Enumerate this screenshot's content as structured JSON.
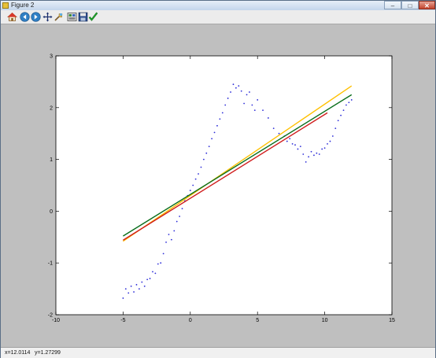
{
  "window": {
    "title": "Figure 2",
    "min_glyph": "–",
    "max_glyph": "□",
    "close_glyph": "✕"
  },
  "toolbar": {
    "tools": [
      "home-icon",
      "back-icon",
      "forward-icon",
      "pan-icon",
      "zoom-icon",
      "configure-subplots-icon",
      "save-icon",
      "edit-axis-icon"
    ]
  },
  "status": {
    "x": "x=12.0114",
    "y": "y=1.27299"
  },
  "chart_data": {
    "type": "scatter",
    "xlim": [
      -10,
      15
    ],
    "ylim": [
      -2,
      3
    ],
    "xticks": [
      -10,
      -5,
      0,
      5,
      10,
      15
    ],
    "yticks": [
      -2,
      -1,
      0,
      1,
      2,
      3
    ],
    "grid": false,
    "points": {
      "color": "#2c2cd8",
      "x": [
        -5,
        -4.8,
        -4.6,
        -4.4,
        -4.2,
        -4,
        -3.8,
        -3.6,
        -3.4,
        -3.2,
        -3,
        -2.8,
        -2.6,
        -2.4,
        -2.2,
        -2,
        -1.8,
        -1.6,
        -1.4,
        -1.2,
        -1,
        -0.8,
        -0.6,
        -0.4,
        -0.2,
        0,
        0.2,
        0.4,
        0.6,
        0.8,
        1,
        1.2,
        1.4,
        1.6,
        1.8,
        2,
        2.2,
        2.4,
        2.6,
        2.8,
        3,
        3.2,
        3.4,
        3.6,
        3.8,
        4,
        4.2,
        4.4,
        4.6,
        4.8,
        5,
        5.4,
        5.8,
        6.2,
        6.6,
        7,
        7.2,
        7.4,
        7.6,
        7.8,
        8,
        8.2,
        8.4,
        8.6,
        8.8,
        9,
        9.2,
        9.4,
        9.6,
        9.8,
        10,
        10.2,
        10.4,
        10.6,
        10.8,
        11,
        11.2,
        11.4,
        11.6,
        11.8,
        12
      ],
      "y": [
        -1.68,
        -1.5,
        -1.58,
        -1.45,
        -1.56,
        -1.42,
        -1.5,
        -1.37,
        -1.45,
        -1.32,
        -1.3,
        -1.17,
        -1.2,
        -1.02,
        -1,
        -0.82,
        -0.6,
        -0.45,
        -0.55,
        -0.38,
        -0.2,
        -0.1,
        0.05,
        0.2,
        0.3,
        0.4,
        0.5,
        0.62,
        0.72,
        0.85,
        1,
        1.12,
        1.25,
        1.4,
        1.52,
        1.65,
        1.78,
        1.9,
        2.05,
        2.18,
        2.3,
        2.45,
        2.38,
        2.42,
        2.32,
        2.08,
        2.25,
        2.3,
        2.05,
        1.95,
        2.15,
        1.95,
        1.8,
        1.6,
        1.5,
        1.45,
        1.35,
        1.4,
        1.3,
        1.28,
        1.2,
        1.25,
        1.1,
        0.95,
        1.05,
        1.15,
        1.08,
        1.12,
        1.1,
        1.2,
        1.22,
        1.3,
        1.35,
        1.45,
        1.6,
        1.75,
        1.85,
        1.95,
        2.05,
        2.1,
        2.15
      ]
    },
    "lines": [
      {
        "color": "#ffc000",
        "x": [
          -5,
          12
        ],
        "y": [
          -0.58,
          2.42
        ]
      },
      {
        "color": "#d01c1c",
        "x": [
          -5,
          10.2
        ],
        "y": [
          -0.56,
          1.9
        ]
      },
      {
        "color": "#0a6e1c",
        "x": [
          -5,
          12
        ],
        "y": [
          -0.48,
          2.25
        ]
      }
    ]
  }
}
